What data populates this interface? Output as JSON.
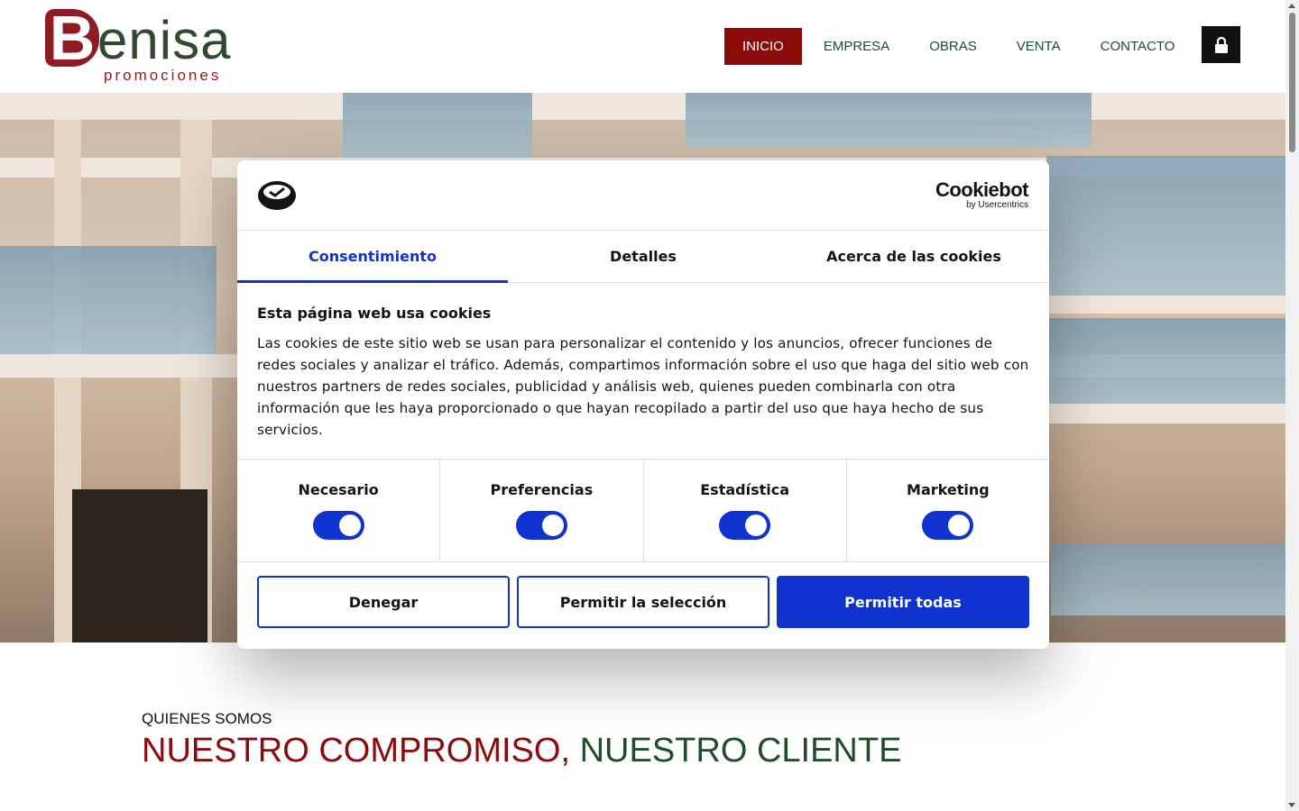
{
  "header": {
    "logo_letter": "B",
    "logo_word": "enisa",
    "logo_sub": "promociones",
    "nav": [
      {
        "label": "INICIO",
        "active": true
      },
      {
        "label": "EMPRESA",
        "active": false
      },
      {
        "label": "OBRAS",
        "active": false
      },
      {
        "label": "VENTA",
        "active": false
      },
      {
        "label": "CONTACTO",
        "active": false
      }
    ],
    "lock_icon": "lock-icon"
  },
  "section": {
    "kicker": "QUIENES SOMOS",
    "title_part1": "NUESTRO COMPROMISO,",
    "title_part2": "NUESTRO CLIENTE"
  },
  "cookie_dialog": {
    "brand_name": "Cookiebot",
    "brand_by": "by Usercentrics",
    "tabs": [
      "Consentimiento",
      "Detalles",
      "Acerca de las cookies"
    ],
    "active_tab": "Consentimiento",
    "heading": "Esta página web usa cookies",
    "text": "Las cookies de este sitio web se usan para personalizar el contenido y los anuncios, ofrecer funciones de redes sociales y analizar el tráfico. Además, compartimos información sobre el uso que haga del sitio web con nuestros partners de redes sociales, publicidad y análisis web, quienes pueden combinarla con otra información que les haya proporcionado o que hayan recopilado a partir del uso que haya hecho de sus servicios.",
    "categories": [
      {
        "label": "Necesario",
        "on": true
      },
      {
        "label": "Preferencias",
        "on": true
      },
      {
        "label": "Estadística",
        "on": true
      },
      {
        "label": "Marketing",
        "on": true
      }
    ],
    "buttons": {
      "deny": "Denegar",
      "allow_selection": "Permitir la selección",
      "allow_all": "Permitir todas"
    }
  },
  "colors": {
    "brand_red": "#8b0b0b",
    "brand_green": "#1e4d2b",
    "cookiebot_blue": "#1032cf"
  }
}
